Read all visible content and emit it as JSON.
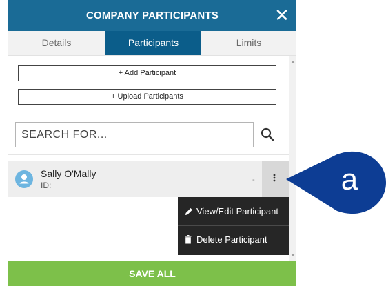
{
  "header": {
    "title": "COMPANY PARTICIPANTS",
    "close_symbol": "✕"
  },
  "tabs": [
    {
      "label": "Details",
      "active": false
    },
    {
      "label": "Participants",
      "active": true
    },
    {
      "label": "Limits",
      "active": false
    }
  ],
  "actions": {
    "add_participant": "+ Add Participant",
    "upload_participants": "+ Upload Participants"
  },
  "search": {
    "placeholder": "SEARCH FOR...",
    "value": ""
  },
  "participants": [
    {
      "name": "Sally O'Mally",
      "id_label": "ID:",
      "id_value": "",
      "status": "-"
    }
  ],
  "context_menu": {
    "items": [
      {
        "label": "View/Edit Participant",
        "icon": "pencil-icon"
      },
      {
        "label": "Delete Participant",
        "icon": "trash-icon"
      }
    ]
  },
  "footer": {
    "save_label": "SAVE ALL"
  },
  "callout": {
    "letter": "a"
  },
  "colors": {
    "header": "#1a6b96",
    "active_tab": "#0b5d8a",
    "save_button": "#7dc04a",
    "menu_bg": "#262626",
    "avatar": "#6db5e0",
    "callout": "#0d3d94"
  }
}
